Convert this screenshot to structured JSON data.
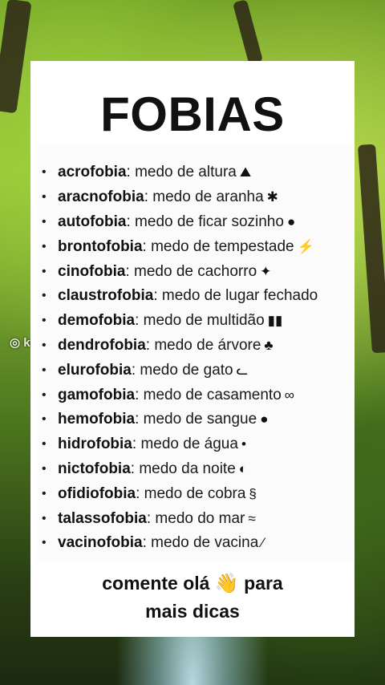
{
  "title": "FOBIAS",
  "items": [
    {
      "term": "acrofobia",
      "desc": ": medo de altura",
      "icon": "climber-icon",
      "glyph": "⛰"
    },
    {
      "term": "aracnofobia",
      "desc": ": medo de aranha",
      "icon": "spider-icon",
      "glyph": "✱"
    },
    {
      "term": "autofobia",
      "desc": ": medo de ficar sozinho",
      "icon": "person-icon",
      "glyph": "●"
    },
    {
      "term": "brontofobia",
      "desc": ": medo de tempestade",
      "icon": "lightning-icon",
      "glyph": "⚡"
    },
    {
      "term": "cinofobia",
      "desc": ": medo de cachorro",
      "icon": "dog-icon",
      "glyph": "✦"
    },
    {
      "term": "claustrofobia",
      "desc": ": medo de lugar fechado",
      "icon": "",
      "glyph": ""
    },
    {
      "term": "demofobia",
      "desc": ": medo de multidão",
      "icon": "crowd-icon",
      "glyph": "▮▮"
    },
    {
      "term": "dendrofobia",
      "desc": ": medo de árvore",
      "icon": "tree-icon",
      "glyph": "♣"
    },
    {
      "term": "elurofobia",
      "desc": ": medo de gato",
      "icon": "cat-icon",
      "glyph": "ᓚ"
    },
    {
      "term": "gamofobia",
      "desc": ": medo de casamento",
      "icon": "rings-icon",
      "glyph": "∞"
    },
    {
      "term": "hemofobia",
      "desc": ": medo de sangue",
      "icon": "blood-drop-icon",
      "glyph": "●"
    },
    {
      "term": "hidrofobia",
      "desc": ": medo de água",
      "icon": "water-drop-icon",
      "glyph": "•"
    },
    {
      "term": "nictofobia",
      "desc": ": medo da noite",
      "icon": "moon-icon",
      "glyph": "◐"
    },
    {
      "term": "ofidiofobia",
      "desc": ": medo de cobra",
      "icon": "snake-icon",
      "glyph": "§"
    },
    {
      "term": "talassofobia",
      "desc": ": medo do mar",
      "icon": "wave-icon",
      "glyph": "≈"
    },
    {
      "term": "vacinofobia",
      "desc": ": medo de vacina",
      "icon": "syringe-icon",
      "glyph": "⁄"
    }
  ],
  "footer": {
    "line1_before": "comente olá",
    "emoji": "👋",
    "line1_after": "para",
    "line2": "mais dicas"
  }
}
